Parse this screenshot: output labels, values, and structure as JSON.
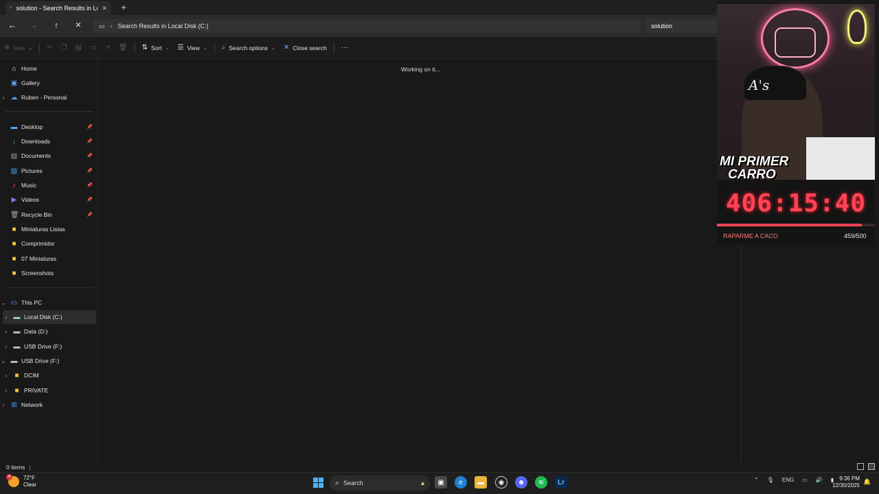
{
  "window": {
    "tab_title": "solution - Search Results in Lo",
    "address_path": "Search Results in Local Disk (C:)",
    "search_query": "solution"
  },
  "toolbar": {
    "new_label": "New",
    "sort_label": "Sort",
    "view_label": "View",
    "search_options_label": "Search options",
    "close_search_label": "Close search",
    "more_label": "···"
  },
  "sidebar": {
    "top_items": [
      {
        "label": "Home",
        "icon": "home-icon"
      },
      {
        "label": "Gallery",
        "icon": "gallery-icon"
      },
      {
        "label": "Ruben - Personal",
        "icon": "cloud-icon"
      }
    ],
    "quick_access": [
      {
        "label": "Desktop",
        "icon": "desktop-icon",
        "pinned": true
      },
      {
        "label": "Downloads",
        "icon": "download-icon",
        "pinned": true
      },
      {
        "label": "Documents",
        "icon": "document-icon",
        "pinned": true
      },
      {
        "label": "Pictures",
        "icon": "picture-icon",
        "pinned": true
      },
      {
        "label": "Music",
        "icon": "music-icon",
        "pinned": true
      },
      {
        "label": "Videos",
        "icon": "video-icon",
        "pinned": true
      },
      {
        "label": "Recycle Bin",
        "icon": "recycle-bin-icon",
        "pinned": true
      },
      {
        "label": "Miniaturas Listas",
        "icon": "folder-icon",
        "pinned": false
      },
      {
        "label": "Comprimidor",
        "icon": "folder-icon",
        "pinned": false
      },
      {
        "label": "07 Miniaturas",
        "icon": "folder-icon",
        "pinned": false
      },
      {
        "label": "Screenshots",
        "icon": "folder-icon",
        "pinned": false
      }
    ],
    "this_pc": "This PC",
    "drives": [
      {
        "label": "Local Disk (C:)",
        "selected": true
      },
      {
        "label": "Data (D:)",
        "selected": false
      },
      {
        "label": "USB Drive (F:)",
        "selected": false
      }
    ],
    "usb_root": "USB Drive (F:)",
    "usb_children": [
      "DCIM",
      "PRIVATE"
    ],
    "network": "Network"
  },
  "content": {
    "status_message": "Working on it..."
  },
  "statusbar": {
    "item_count": "0 items"
  },
  "overlay": {
    "cap_logo": "A's",
    "promo_line1": "MI PRIMER",
    "promo_line2": "CARRO",
    "timer": "406:15:40",
    "goal_label": "RAPARME A CACO",
    "goal_count": "459/500",
    "goal_progress": 0.918
  },
  "taskbar": {
    "weather_temp": "72°F",
    "weather_desc": "Clear",
    "weather_badge": "4",
    "search_label": "Search",
    "lang": "ENG",
    "time": "9:36 PM",
    "date": "12/30/2025"
  }
}
